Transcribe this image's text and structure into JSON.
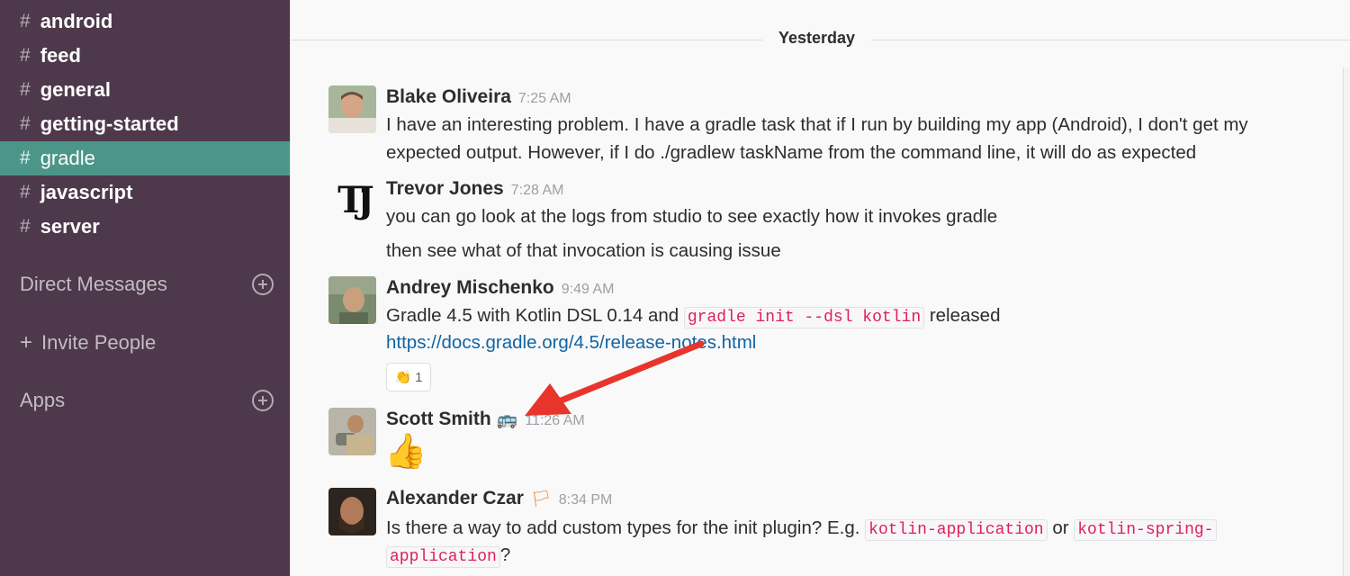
{
  "sidebar": {
    "hash": "#",
    "channels": [
      {
        "label": "android"
      },
      {
        "label": "feed"
      },
      {
        "label": "general"
      },
      {
        "label": "getting-started"
      },
      {
        "label": "gradle",
        "active": true
      },
      {
        "label": "javascript"
      },
      {
        "label": "server"
      }
    ],
    "direct_messages": "Direct Messages",
    "invite_plus": "+",
    "invite_people": "Invite People",
    "apps": "Apps"
  },
  "main": {
    "day_label": "Yesterday",
    "messages": [
      {
        "author": "Blake Oliveira",
        "time": "7:25 AM",
        "lines": [
          "I have an interesting problem. I have a gradle task that if I run by building my app (Android), I don't get my",
          "expected output. However, if I do ./gradlew taskName from the command line, it will do as expected"
        ]
      },
      {
        "author": "Trevor Jones",
        "time": "7:28 AM",
        "avatar_text": "TJ",
        "lines": [
          "you can go look at the logs from studio to see exactly how it invokes gradle",
          "then see what of that invocation is causing issue"
        ]
      },
      {
        "author": "Andrey Mischenko",
        "time": "9:49 AM",
        "text_before": "Gradle 4.5 with Kotlin DSL 0.14 and",
        "code": "gradle init --dsl kotlin",
        "text_after": "released",
        "link": "https://docs.gradle.org/4.5/release-notes.html",
        "reaction_emoji": "👏",
        "reaction_count": "1"
      },
      {
        "author": "Scott Smith",
        "status_emoji": "🚌",
        "time": "11:26 AM",
        "emoji": "👍"
      },
      {
        "author": "Alexander Czar",
        "status_emoji": "🏳",
        "time": "8:34 PM",
        "text_before": "Is there a way to add custom types for the init plugin? E.g.",
        "code1": "kotlin-application",
        "text_mid": "or",
        "code2_line1": "kotlin-spring-",
        "code2_line2": "application",
        "text_after": "?"
      }
    ]
  },
  "colors": {
    "sidebar_bg": "#4d394b",
    "active_channel": "#4c9689",
    "link": "#1264a3",
    "code_text": "#e01e5a",
    "annotation_arrow": "#e8352b"
  }
}
